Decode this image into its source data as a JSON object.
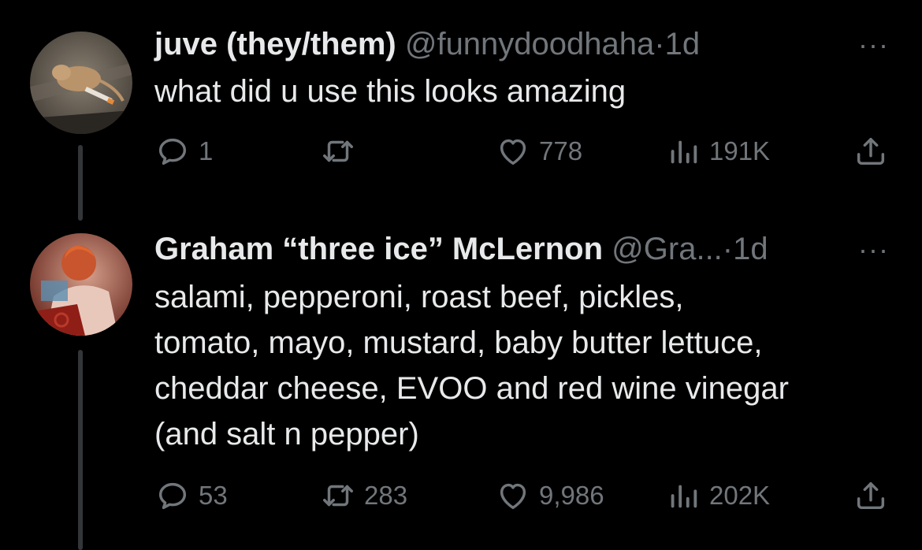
{
  "tweets": [
    {
      "display_name": "juve (they/them)",
      "handle": "@funnydoodhaha",
      "separator": "·",
      "time": "1d",
      "more": "···",
      "text_lines": [
        "what did u use this looks amazing"
      ],
      "replies": "1",
      "retweets": "",
      "likes": "778",
      "views": "191K",
      "avatar_icon": "rat-avatar-icon"
    },
    {
      "display_name": "Graham “three ice” McLernon",
      "handle": "@Gra...",
      "separator": "·",
      "time": "1d",
      "more": "···",
      "text_lines": [
        "salami, pepperoni, roast beef, pickles,",
        "tomato, mayo, mustard, baby butter lettuce,",
        "cheddar cheese, EVOO and red wine vinegar",
        "(and salt n pepper)"
      ],
      "replies": "53",
      "retweets": "283",
      "likes": "9,986",
      "views": "202K",
      "avatar_icon": "person-avatar-icon"
    }
  ],
  "colors": {
    "background": "#000000",
    "text": "#e7e9ea",
    "muted": "#71767b",
    "thread_line": "#333639"
  }
}
